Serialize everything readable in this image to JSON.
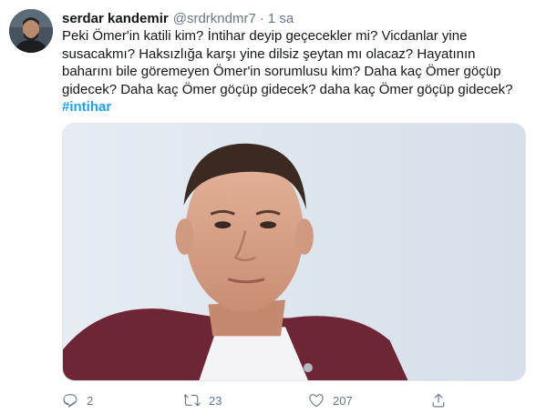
{
  "tweet": {
    "display_name": "serdar kandemir",
    "handle": "@srdrkndmr7",
    "separator": "·",
    "time": "1 sa",
    "text_lines": [
      "Peki Ömer'in katili kim? İntihar deyip geçecekler mi? Vicdanlar yine",
      "susacakmı? Haksızlığa karşı yine dilsiz şeytan mı olacaz? Hayatının",
      "baharını bile göremeyen Ömer'in sorumlusu kim? Daha kaç Ömer göçüp",
      "gidecek? Daha kaç Ömer göçüp gidecek? daha kaç Ömer göçüp gidecek?"
    ],
    "hashtag": "#intihar",
    "hashtag_color": "#1da1f2",
    "actions": {
      "reply": {
        "icon": "reply-icon",
        "count": "2"
      },
      "retweet": {
        "icon": "retweet-icon",
        "count": "23"
      },
      "like": {
        "icon": "heart-icon",
        "count": "207"
      },
      "share": {
        "icon": "share-icon"
      }
    }
  }
}
